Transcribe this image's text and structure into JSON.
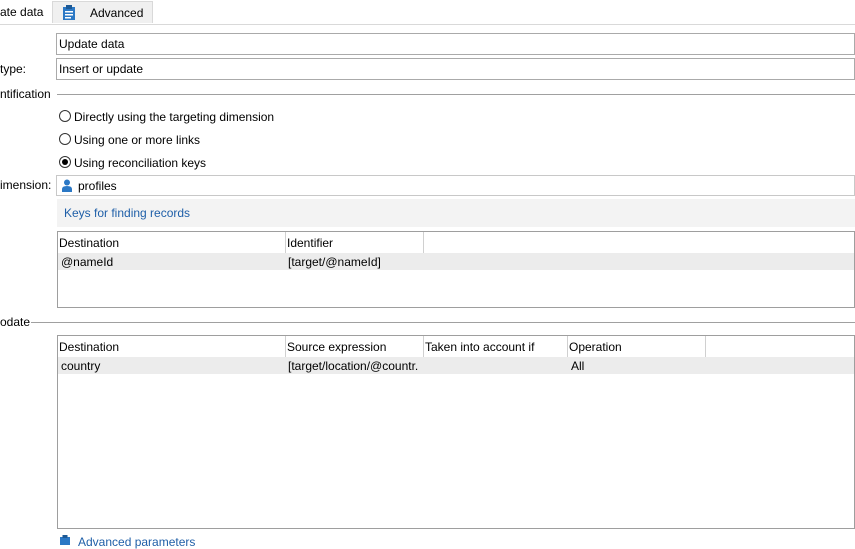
{
  "tabs": {
    "active_label": "ate data",
    "advanced_label": "Advanced"
  },
  "form": {
    "label_value": "Update data",
    "type_label": "type:",
    "type_value": "Insert or update",
    "identification_heading": "ntification",
    "radios": [
      {
        "label": "Directly using the targeting dimension",
        "selected": false
      },
      {
        "label": "Using one or more links",
        "selected": false
      },
      {
        "label": "Using reconciliation keys",
        "selected": true
      }
    ],
    "dimension_label": "imension:",
    "dimension_value": "profiles",
    "keys_link": "Keys for finding records"
  },
  "keys_table": {
    "columns": [
      "Destination",
      "Identifier"
    ],
    "rows": [
      [
        "@nameId",
        "[target/@nameId]"
      ]
    ]
  },
  "update_section": {
    "heading": "odate"
  },
  "update_table": {
    "columns": [
      "Destination",
      "Source expression",
      "Taken into account if",
      "Operation"
    ],
    "rows": [
      [
        "country",
        "[target/location/@countr.",
        "",
        "All"
      ]
    ]
  },
  "footer": {
    "advanced_params_link": "Advanced parameters"
  },
  "colors": {
    "link": "#1f5fa8",
    "icon_blue": "#2b78c5",
    "selected_row": "#ececec"
  }
}
